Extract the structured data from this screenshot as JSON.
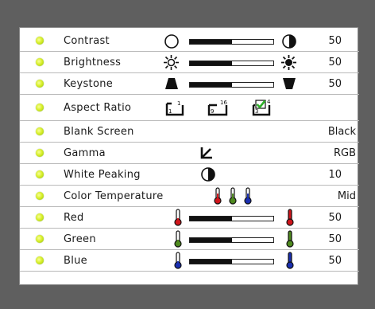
{
  "menu": {
    "rows": [
      {
        "label": "Contrast",
        "value": "50",
        "level": 0.5
      },
      {
        "label": "Brightness",
        "value": "50",
        "level": 0.5
      },
      {
        "label": "Keystone",
        "value": "50",
        "level": 0.5
      },
      {
        "label": "Aspect Ratio",
        "options": [
          {
            "icon": "aspect-1-1-icon",
            "num": "1",
            "denom": "1"
          },
          {
            "icon": "aspect-16-9-icon",
            "num": "16",
            "denom": "9"
          },
          {
            "icon": "aspect-4-3-icon",
            "num": "4",
            "denom": "3",
            "selected": true
          }
        ]
      },
      {
        "label": "Blank Screen",
        "value": "Black"
      },
      {
        "label": "Gamma",
        "value": "RGB"
      },
      {
        "label": "White Peaking",
        "value": "10"
      },
      {
        "label": "Color Temperature",
        "value": "Mid"
      },
      {
        "label": "Red",
        "value": "50",
        "level": 0.5
      },
      {
        "label": "Green",
        "value": "50",
        "level": 0.5
      },
      {
        "label": "Blue",
        "value": "50",
        "level": 0.5
      }
    ]
  },
  "colors": {
    "background": "#5f5f5f",
    "panel": "#ffffff",
    "bullet": "#c8e62a",
    "red": "#d0151b",
    "green": "#4f8a1f",
    "blue": "#1a2fb0",
    "check": "#2fb02a"
  }
}
